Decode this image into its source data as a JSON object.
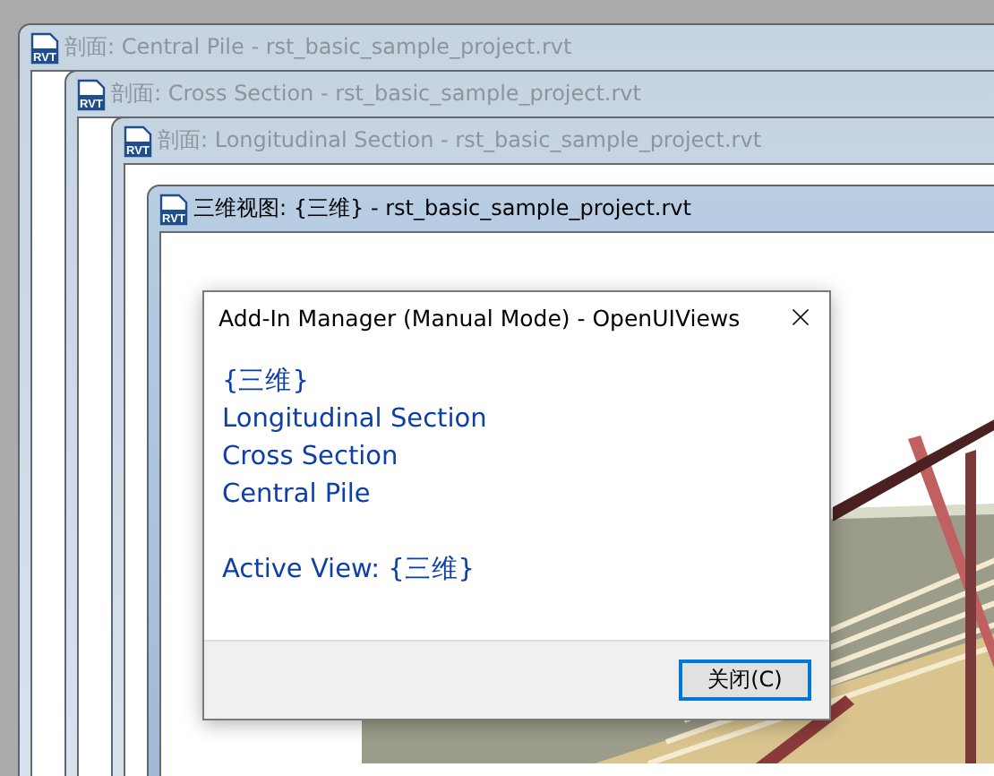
{
  "windows": [
    {
      "icon_text": "RVT",
      "title": "剖面: Central Pile - rst_basic_sample_project.rvt",
      "active": false
    },
    {
      "icon_text": "RVT",
      "title": "剖面: Cross Section - rst_basic_sample_project.rvt",
      "active": false
    },
    {
      "icon_text": "RVT",
      "title": "剖面: Longitudinal Section - rst_basic_sample_project.rvt",
      "active": false
    },
    {
      "icon_text": "RVT",
      "title": "三维视图: {三维} - rst_basic_sample_project.rvt",
      "active": true
    }
  ],
  "dialog": {
    "title": "Add-In Manager (Manual Mode) - OpenUIViews",
    "lines": [
      "{三维}",
      "Longitudinal Section",
      "Cross Section",
      "Central Pile"
    ],
    "active_view": "Active View: {三维}",
    "button": {
      "label": "关闭(C)",
      "focused": true
    }
  }
}
